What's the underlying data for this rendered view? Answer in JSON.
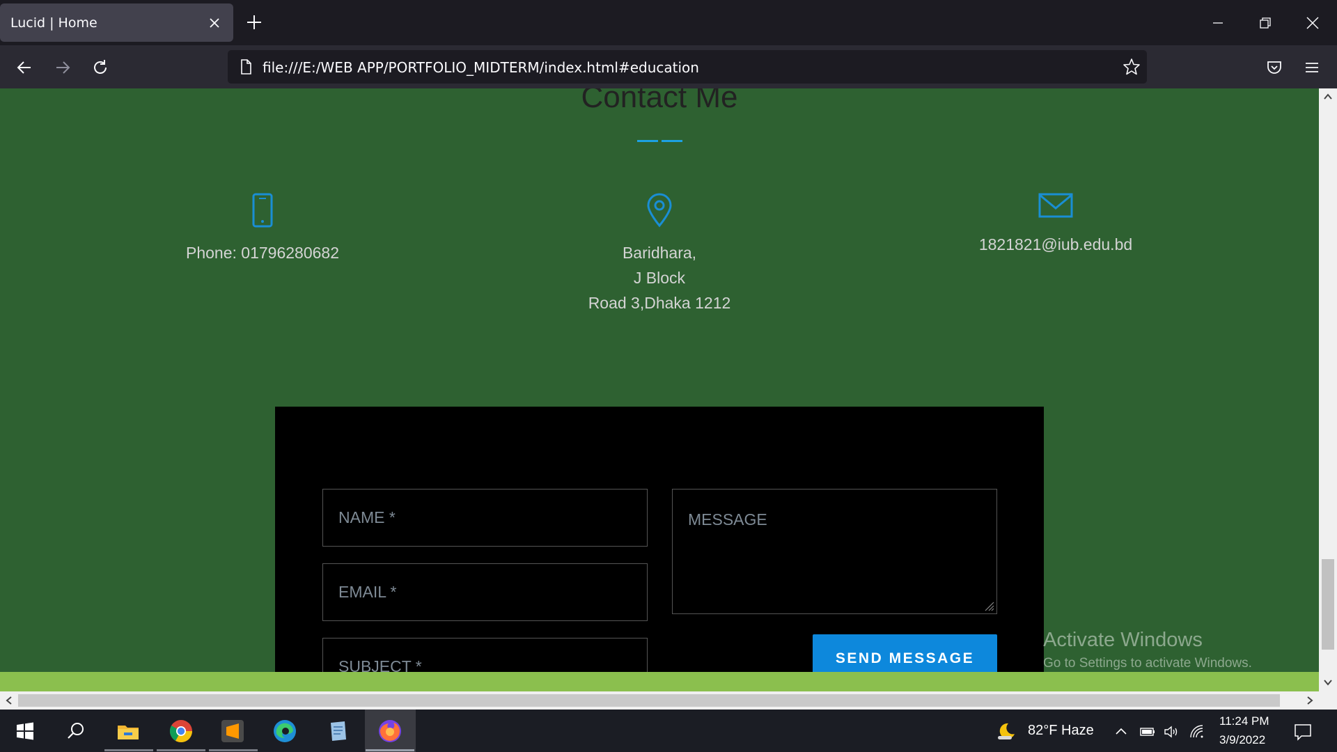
{
  "browser": {
    "tab_title": "Lucid | Home",
    "url": "file:///E:/WEB APP/PORTFOLIO_MIDTERM/index.html#education"
  },
  "page": {
    "section_title": "Contact Me",
    "phone_text": "Phone: 01796280682",
    "address_lines": [
      "Baridhara,",
      "J Block",
      "Road 3,Dhaka 1212"
    ],
    "email_text": "1821821@iub.edu.bd",
    "form": {
      "name_placeholder": "NAME *",
      "email_placeholder": "EMAIL *",
      "subject_placeholder": "SUBJECT *",
      "message_placeholder": "MESSAGE",
      "send_label": "SEND MESSAGE"
    },
    "colors": {
      "page_background": "#2e6131",
      "accent": "#0d88dc",
      "form_background": "#000000",
      "footer_strip": "#8bbf4e"
    }
  },
  "watermark": {
    "line1": "Activate Windows",
    "line2": "Go to Settings to activate Windows."
  },
  "taskbar": {
    "apps": [
      "start-icon",
      "search-icon",
      "file-explorer-icon",
      "chrome-icon",
      "sublime-text-icon",
      "edge-icon",
      "notepad-icon",
      "firefox-icon"
    ],
    "weather": "82°F  Haze",
    "time": "11:24 PM",
    "date": "3/9/2022"
  }
}
